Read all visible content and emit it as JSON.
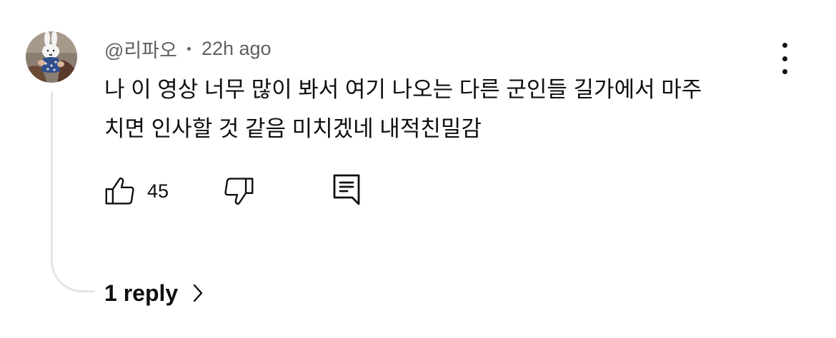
{
  "comment": {
    "author": "@리파오",
    "timestamp": "22h ago",
    "text_lines": [
      "나 이 영상 너무 많이 봐서 여기 나오는 다른 군인들 길가에서 마주",
      "치면 인사할 것 같음 미치겠네 내적친밀감"
    ],
    "like_count": "45"
  },
  "replies": {
    "label": "1 reply"
  },
  "icons": {
    "like": "thumbs-up-icon",
    "dislike": "thumbs-down-icon",
    "reply": "comment-reply-icon",
    "more": "more-vertical-icon",
    "expand": "chevron-right-icon"
  },
  "colors": {
    "text_primary": "#0f0f0f",
    "text_secondary": "#606060",
    "thread_line": "#e5e5e5"
  }
}
